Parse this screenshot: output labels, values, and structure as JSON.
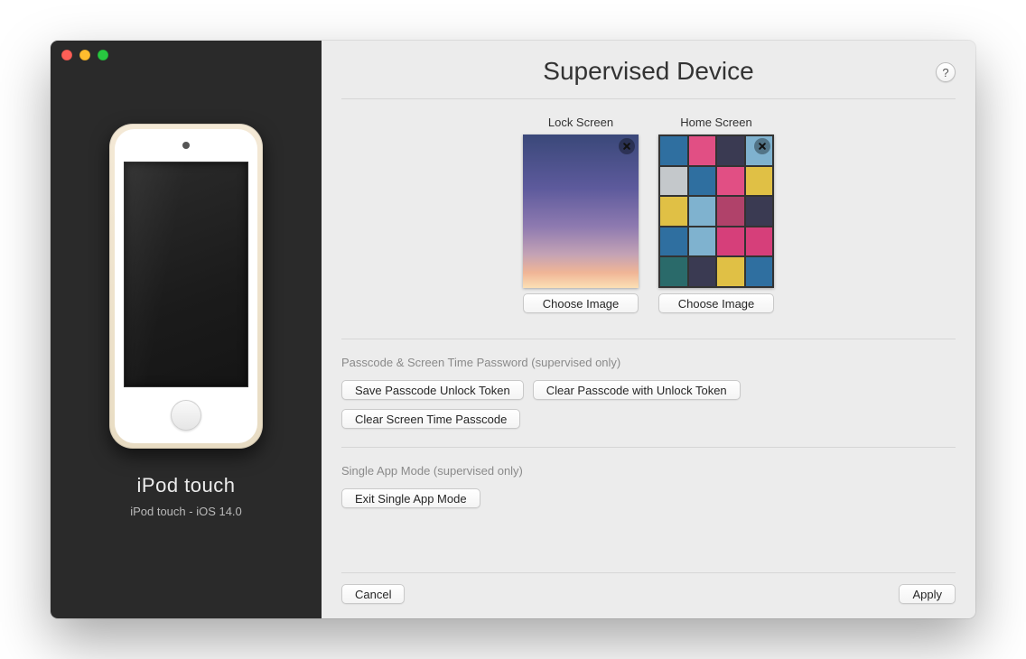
{
  "sidebar": {
    "device_name": "iPod touch",
    "device_subtitle": "iPod touch - iOS 14.0"
  },
  "header": {
    "title": "Supervised Device",
    "help": "?"
  },
  "screenshots": {
    "lock_label": "Lock Screen",
    "home_label": "Home Screen",
    "choose_image": "Choose Image"
  },
  "passcode_section": {
    "label": "Passcode & Screen Time Password (supervised only)",
    "save_token": "Save Passcode Unlock Token",
    "clear_passcode": "Clear Passcode with Unlock Token",
    "clear_screentime": "Clear Screen Time Passcode"
  },
  "single_app_section": {
    "label": "Single App Mode (supervised only)",
    "exit": "Exit Single App Mode"
  },
  "footer": {
    "cancel": "Cancel",
    "apply": "Apply"
  },
  "home_tiles": [
    "#2f6fa0",
    "#e14f84",
    "#3a3a52",
    "#7fb2cf",
    "#c4c8cb",
    "#2f6fa0",
    "#e14f84",
    "#e0c045",
    "#e0c045",
    "#7fb2cf",
    "#b0426a",
    "#3a3a52",
    "#2f6fa0",
    "#7fb2cf",
    "#d63f7a",
    "#d63f7a",
    "#2a6a6a",
    "#3a3a52",
    "#e0c045",
    "#2f6fa0"
  ]
}
